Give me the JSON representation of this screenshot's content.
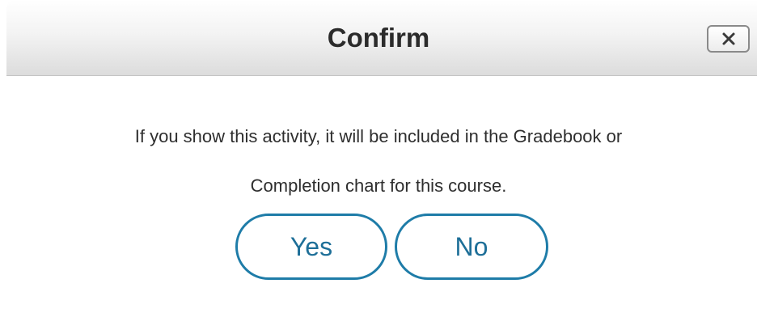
{
  "dialog": {
    "title": "Confirm",
    "close_icon": "close-icon",
    "message_lines": [
      "If you show this activity, it will be included in the Gradebook or",
      "Completion chart for this course."
    ],
    "buttons": {
      "yes_label": "Yes",
      "no_label": "No"
    },
    "colors": {
      "button_border": "#1e7ca8",
      "button_text": "#1e6f98",
      "title_text": "#2b2b2b"
    }
  }
}
